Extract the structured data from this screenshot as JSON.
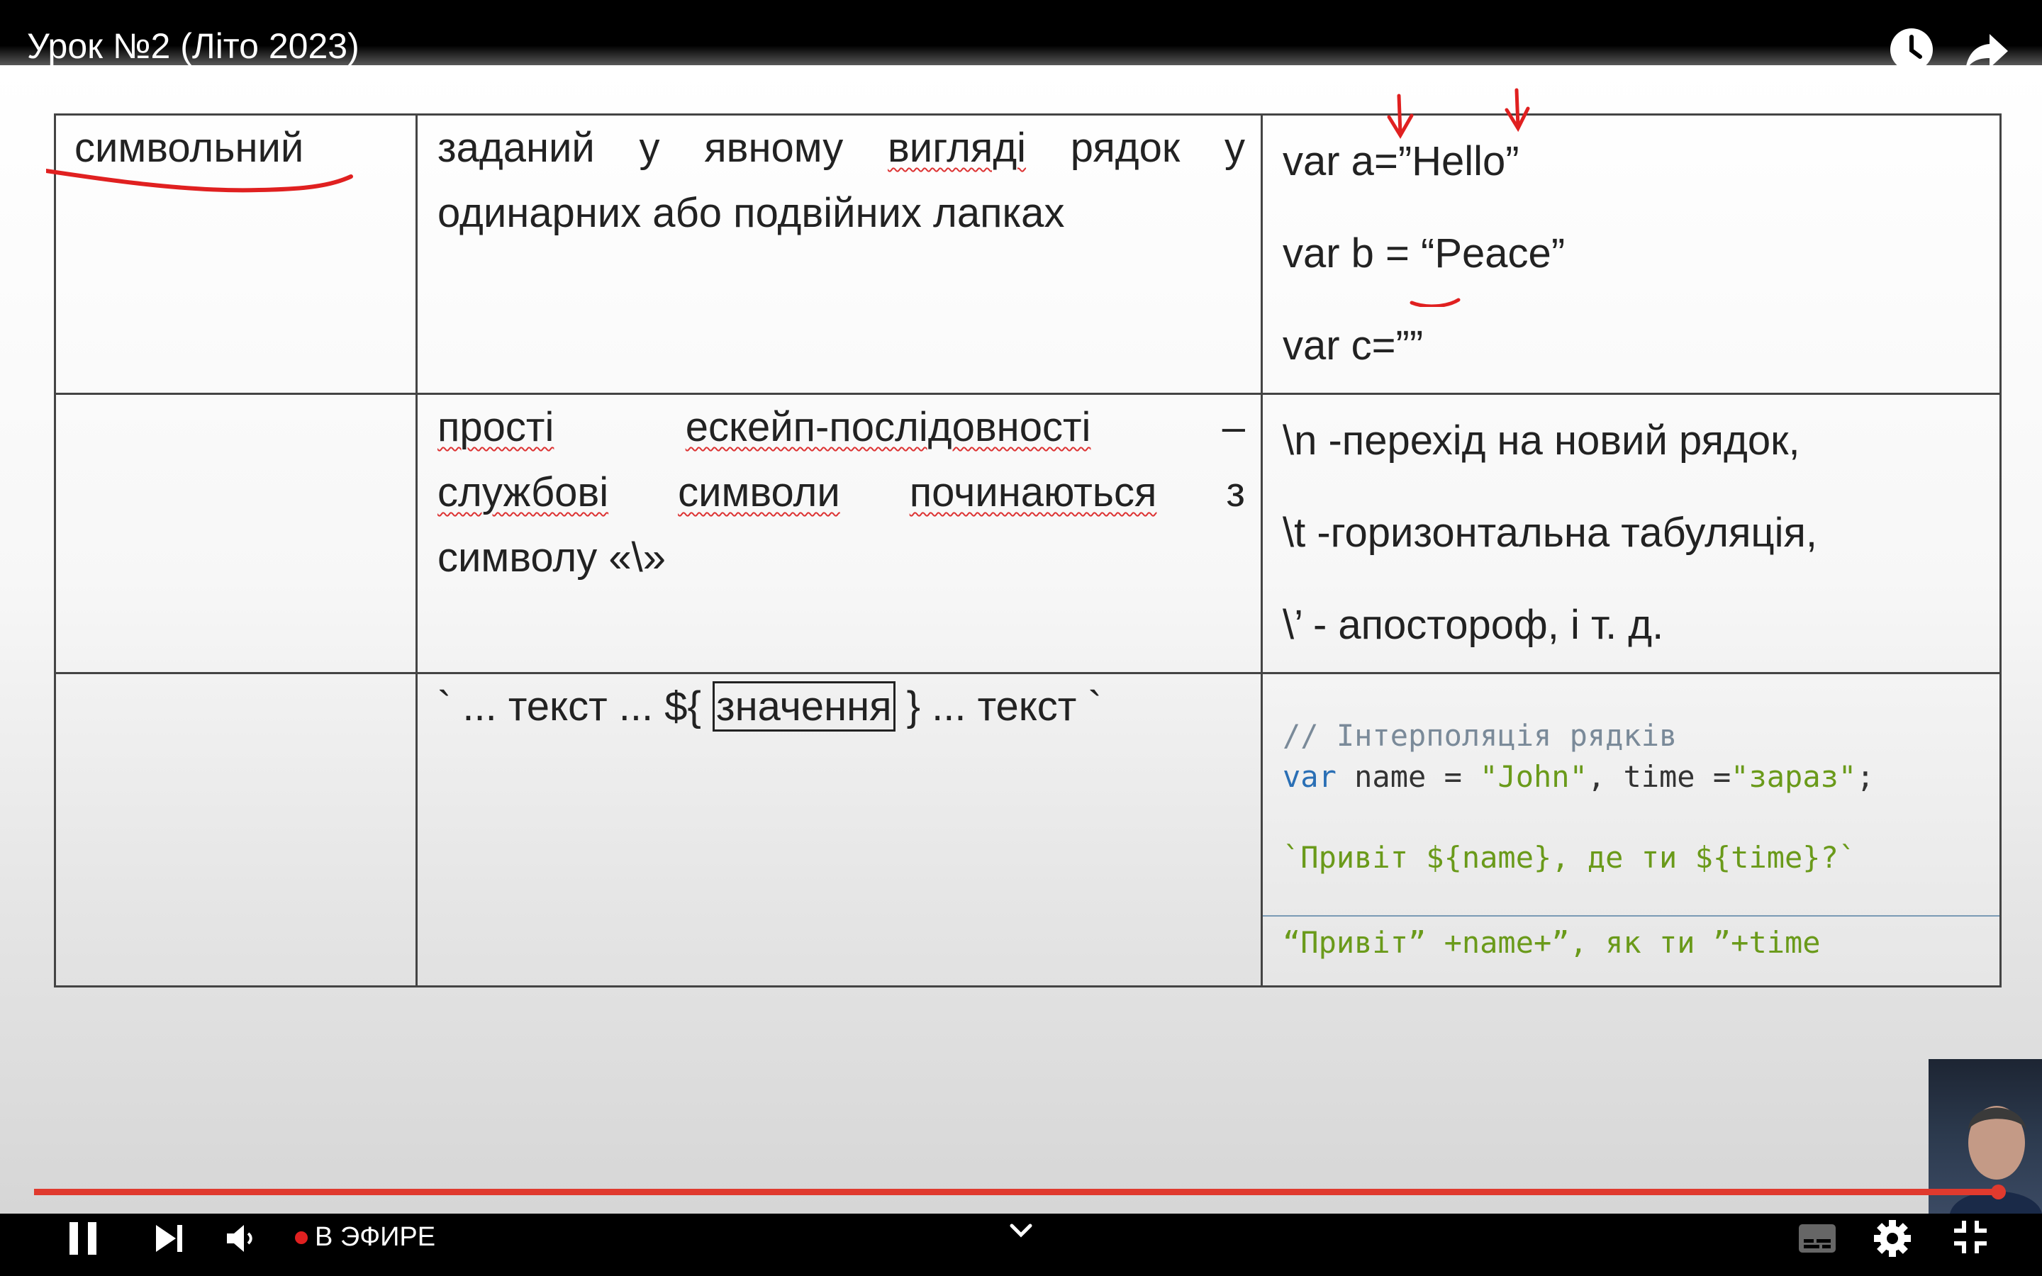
{
  "window": {
    "title": "Урок №2 (Літо 2023)"
  },
  "top_icons": [
    "clock-icon",
    "share-icon"
  ],
  "slide": {
    "row1": {
      "type": "символьний",
      "desc_line1": [
        "заданий",
        "у",
        "явному",
        "вигляді",
        "рядок",
        "у"
      ],
      "desc_line2": "одинарних або подвійних лапках",
      "ex_a": "var a=”Hello”",
      "ex_b": "var b = “Peace”",
      "ex_c": "var c=””"
    },
    "row2": {
      "desc_line1": [
        "прості",
        "ескейп-послідовності",
        "–"
      ],
      "desc_line2": [
        "службові",
        "символи",
        "починаються",
        "з"
      ],
      "desc_line3": "символу  «\\»",
      "ex_n": "\\n -перехід на новий  рядок,",
      "ex_t": "\\t -горизонтальна табуляція,",
      "ex_ap": "\\’ - апостороф, і т. д."
    },
    "row3": {
      "template_pre": "` ... текст ... ${",
      "template_boxed": "значення",
      "template_post": "} ... текст `",
      "code_comment": "// Інтерполяція рядків",
      "code_var_kw": "var",
      "code_var_rest1": " name = ",
      "code_str_john": "\"John\"",
      "code_var_rest2": ", time =",
      "code_str_zaraz": "\"зараз\"",
      "code_semi": ";",
      "code_tpl": "`Привіт ${name}, де ти ${time}?`",
      "code_concat": "“Привіт” +name+”, як ти ”+time"
    }
  },
  "controls": {
    "live_label": "В ЭФИРЕ",
    "icons": [
      "pause-icon",
      "next-icon",
      "volume-icon",
      "chevron-down-icon",
      "subtitles-icon",
      "settings-icon",
      "exit-fullscreen-icon"
    ],
    "progress_fraction": 0.995,
    "accent": "#e03a2e"
  }
}
